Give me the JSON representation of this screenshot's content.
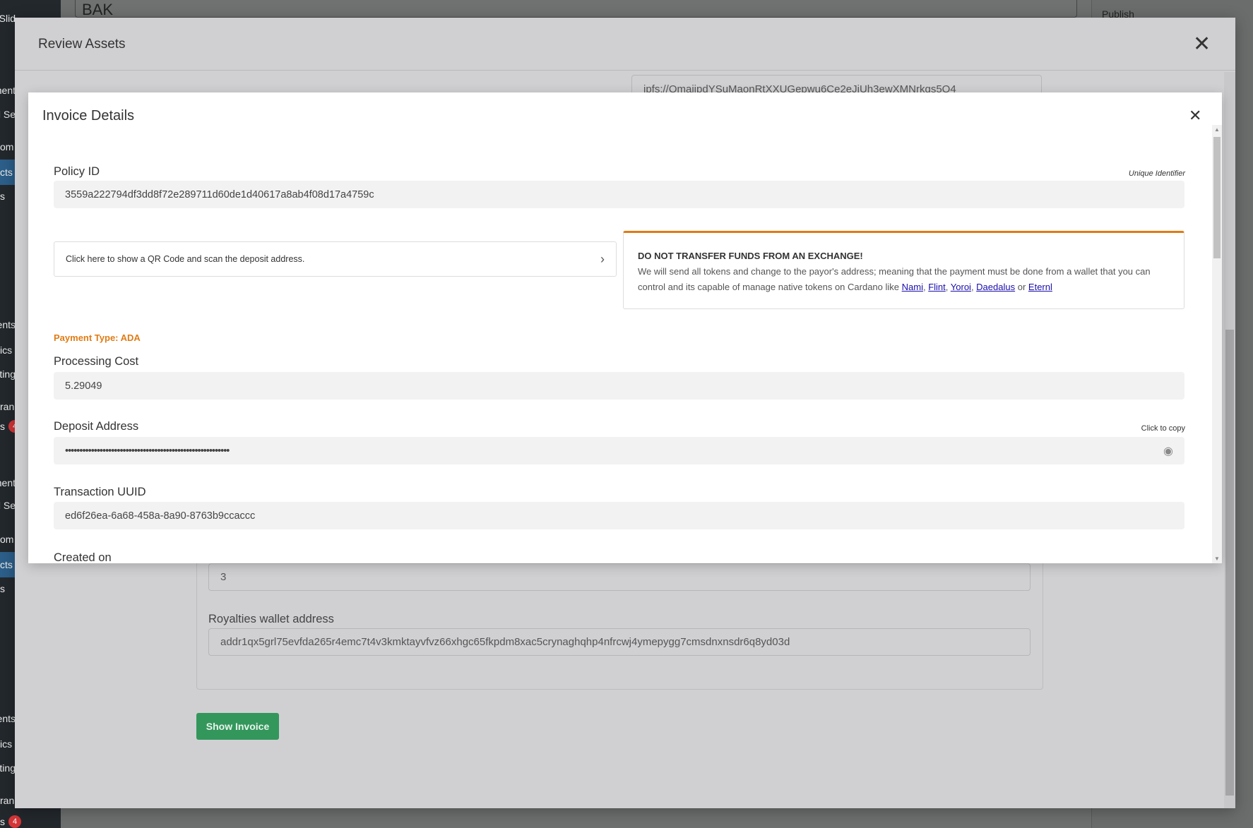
{
  "background": {
    "sidebar_items": [
      {
        "label": "r Slid"
      },
      {
        "label": "ment"
      },
      {
        "label": "l Se"
      },
      {
        "label": "om"
      },
      {
        "label": "cts",
        "active": true
      },
      {
        "label": "s"
      },
      {
        "label": "ents"
      },
      {
        "label": "ics"
      },
      {
        "label": "ting"
      },
      {
        "label": "ran"
      },
      {
        "label": "s",
        "badge": "4"
      },
      {
        "label": "ment"
      },
      {
        "label": "l Se"
      },
      {
        "label": "om"
      },
      {
        "label": "cts",
        "active": true
      },
      {
        "label": "s"
      },
      {
        "label": "ents"
      },
      {
        "label": "ics"
      },
      {
        "label": "ting"
      },
      {
        "label": "ran"
      },
      {
        "label": "s",
        "badge": "4"
      }
    ],
    "title_value": "BAK",
    "publish_label": "Publish"
  },
  "outer_modal": {
    "title": "Review Assets",
    "close_icon": "x-icon",
    "ipfs_value": "ipfs://QmaiipdYSuMaonRtXXUGepwu6Ce2eJiUh3ewXMNrkgs5Q4",
    "quantity_value": "3",
    "royalties_label": "Royalties wallet address",
    "royalties_value": "addr1qx5grl75evfda265r4emc7t4v3kmktayvfvz66xhgc65fkpdm8xac5crynaghqhp4nfrcwj4ymepygg7cmsdnxnsdr6q8yd03d",
    "show_invoice_label": "Show Invoice",
    "button_color": "#33975c"
  },
  "invoice_modal": {
    "title": "Invoice Details",
    "close_icon": "x-icon",
    "policy_id_label": "Policy ID",
    "policy_id_hint": "Unique Identifier",
    "policy_id_value": "3559a222794df3dd8f72e289711d60de1d40617a8ab4f08d17a4759c",
    "qr_prompt": "Click here to show a QR Code and scan the deposit address.",
    "warning": {
      "title": "DO NOT TRANSFER FUNDS FROM AN EXCHANGE!",
      "text": "We will send all tokens and change to the payor's address; meaning that the payment must be done from a wallet that you can control and its capable of manage native tokens on Cardano like",
      "wallets": [
        "Nami",
        "Flint",
        "Yoroi",
        "Daedalus"
      ],
      "or": "or",
      "last_wallet": "Eternl",
      "accent_color": "#e07b14"
    },
    "payment_type": "Payment Type: ADA",
    "processing_cost_label": "Processing Cost",
    "processing_cost_value": "5.29049",
    "deposit_address_label": "Deposit Address",
    "deposit_address_hint": "Click to copy",
    "deposit_address_value": "•••••••••••••••••••••••••••••••••••••••••••••••••••••••••",
    "deposit_eye_icon": "eye-icon",
    "transaction_uuid_label": "Transaction UUID",
    "transaction_uuid_value": "ed6f26ea-6a68-458a-8a90-8763b9ccaccc",
    "created_on_label": "Created on"
  }
}
